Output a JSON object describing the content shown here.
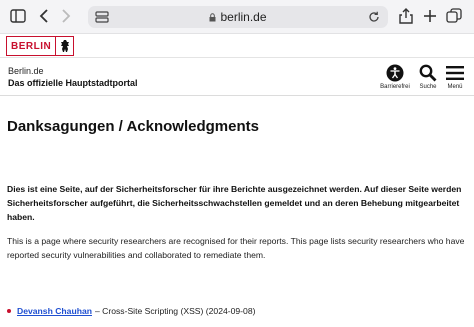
{
  "browser": {
    "url": "berlin.de"
  },
  "brand": {
    "logo_text": "BERLIN"
  },
  "header": {
    "site_name": "Berlin.de",
    "site_subtitle": "Das offizielle Hauptstadtportal",
    "accessibility_label": "Barrierefrei",
    "search_label": "Suche",
    "menu_label": "Menü"
  },
  "main": {
    "title": "Danksagungen / Acknowledgments",
    "intro_de": "Dies ist eine Seite, auf der Sicherheitsforscher für ihre Berichte ausgezeichnet werden. Auf dieser Seite werden Sicherheitsforscher aufgeführt, die Sicherheitsschwachstellen gemeldet und an deren Behebung mitgearbeitet haben.",
    "intro_en": "This is a page where security researchers are recognised for their reports. This page lists security researchers who have reported security vulnerabilities and collaborated to remediate them.",
    "entries": [
      {
        "name": "Devansh Chauhan",
        "detail": "– Cross-Site Scripting (XSS) (2024-09-08)"
      }
    ]
  },
  "colors": {
    "brand_red": "#c8102e",
    "link_blue": "#1f4fd1"
  }
}
